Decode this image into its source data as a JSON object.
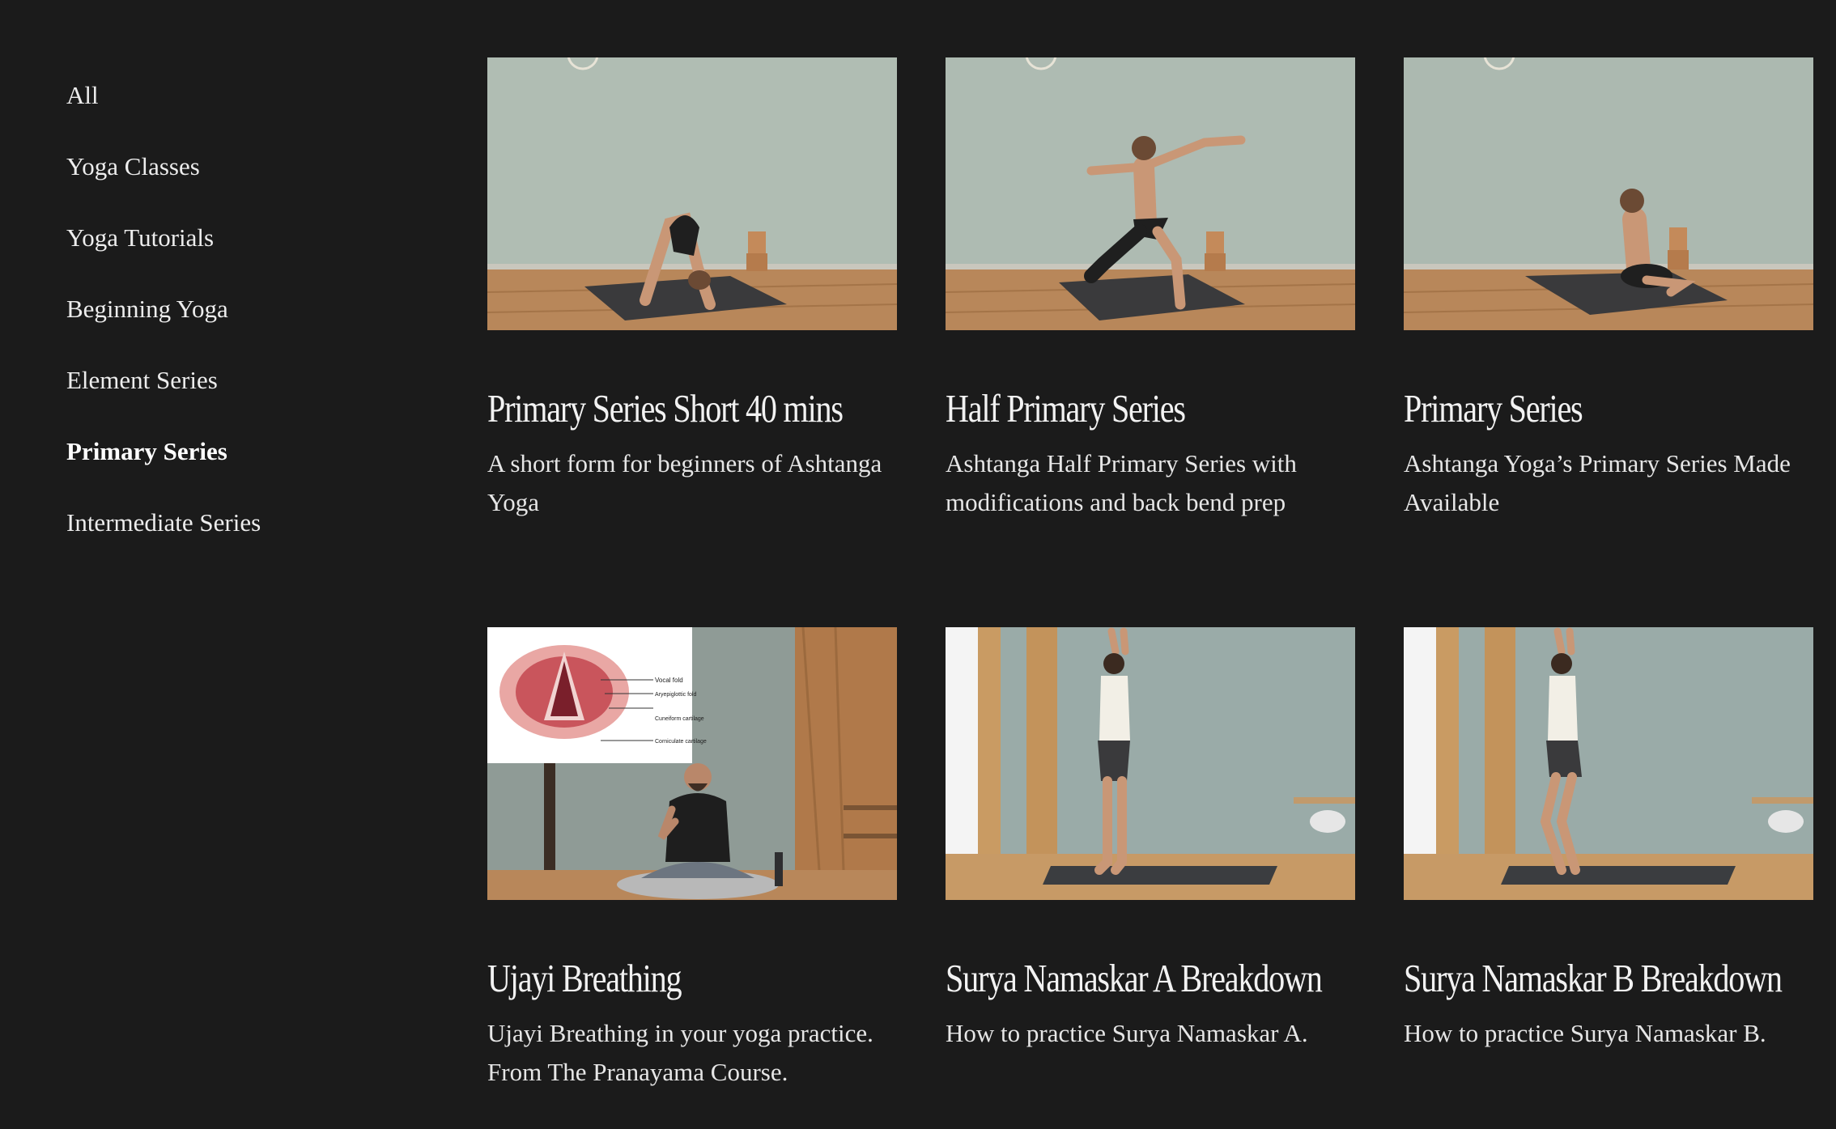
{
  "sidebar": {
    "items": [
      {
        "label": "All"
      },
      {
        "label": "Yoga Classes"
      },
      {
        "label": "Yoga Tutorials"
      },
      {
        "label": "Beginning Yoga"
      },
      {
        "label": "Element Series"
      },
      {
        "label": "Primary Series",
        "active": true
      },
      {
        "label": "Intermediate Series"
      }
    ]
  },
  "cards": [
    {
      "title": "Primary Series Short 40 mins",
      "description": "A short form for beginners of Ashtanga Yoga"
    },
    {
      "title": "Half Primary Series",
      "description": "Ashtanga Half Primary Series with modifications and back bend prep"
    },
    {
      "title": "Primary Series",
      "description": "Ashtanga Yoga’s Primary Series Made Available"
    },
    {
      "title": "Ujayi Breathing",
      "description": "Ujayi Breathing in your yoga practice. From The Pranayama Course."
    },
    {
      "title": "Surya Namaskar A Breakdown",
      "description": "How to practice Surya Namaskar A."
    },
    {
      "title": "Surya Namaskar B Breakdown",
      "description": "How to practice Surya Namaskar B."
    }
  ],
  "diagram_labels": [
    "Vocal fold",
    "Aryepiglottic fold",
    "Cuneiform cartilage",
    "Corniculate cartilage"
  ],
  "colors": {
    "background": "#1b1b1b",
    "text": "#ededed",
    "wall": "#a9b6ad",
    "floor": "#b98a5c",
    "mat": "#3c3c3e"
  }
}
